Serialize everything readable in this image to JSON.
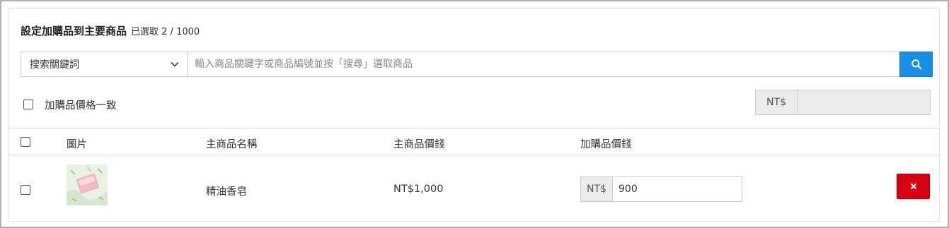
{
  "header": {
    "title": "設定加購品到主要商品",
    "selection_count": "已選取 2 / 1000"
  },
  "search": {
    "select_label": "搜索關鍵詞",
    "placeholder": "輸入商品關鍵字或商品編號並按「搜尋」選取商品",
    "value": ""
  },
  "consistent": {
    "label": "加購品價格一致",
    "checked": false,
    "currency": "NT$",
    "price_value": ""
  },
  "table": {
    "columns": [
      "圖片",
      "主商品名稱",
      "主商品價錢",
      "加購品價錢"
    ],
    "rows": [
      {
        "product_name": "精油香皂",
        "main_price": "NT$1,000",
        "currency": "NT$",
        "addon_price": "900"
      }
    ]
  },
  "colors": {
    "search_button": "#1590e6",
    "delete_button": "#d9010f"
  },
  "icons": {
    "search": "search-icon",
    "dropdown": "chevron-down-icon",
    "delete": "close-icon"
  }
}
